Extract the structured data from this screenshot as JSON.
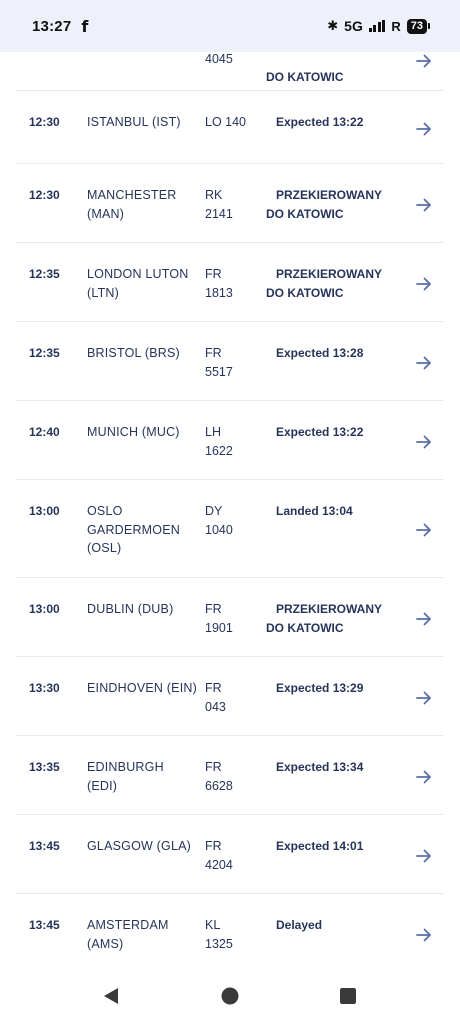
{
  "status_bar": {
    "time": "13:27",
    "network": "5G",
    "battery": "73"
  },
  "flights": [
    {
      "time": "",
      "destination": "",
      "flight_line1": "",
      "flight_line2": "4045",
      "status_line1": "",
      "status_line2": "DO KATOWIC",
      "status_type": "diverted"
    },
    {
      "time": "12:30",
      "destination": "ISTANBUL (IST)",
      "flight_line1": "LO 140",
      "flight_line2": "",
      "status_line1": "Expected 13:22",
      "status_line2": "",
      "status_type": "normal"
    },
    {
      "time": "12:30",
      "destination": "MANCHESTER (MAN)",
      "flight_line1": "RK",
      "flight_line2": "2141",
      "status_line1": "PRZEKIEROWANY",
      "status_line2": "DO KATOWIC",
      "status_type": "diverted"
    },
    {
      "time": "12:35",
      "destination": "LONDON LUTON (LTN)",
      "flight_line1": "FR",
      "flight_line2": "1813",
      "status_line1": "PRZEKIEROWANY",
      "status_line2": "DO KATOWIC",
      "status_type": "diverted"
    },
    {
      "time": "12:35",
      "destination": "BRISTOL (BRS)",
      "flight_line1": "FR",
      "flight_line2": "5517",
      "status_line1": "Expected 13:28",
      "status_line2": "",
      "status_type": "normal"
    },
    {
      "time": "12:40",
      "destination": "MUNICH (MUC)",
      "flight_line1": "LH",
      "flight_line2": "1622",
      "status_line1": "Expected 13:22",
      "status_line2": "",
      "status_type": "normal"
    },
    {
      "time": "13:00",
      "destination": "OSLO GARDERMOEN (OSL)",
      "flight_line1": "DY",
      "flight_line2": "1040",
      "status_line1": "Landed 13:04",
      "status_line2": "",
      "status_type": "normal"
    },
    {
      "time": "13:00",
      "destination": "DUBLIN (DUB)",
      "flight_line1": "FR",
      "flight_line2": "1901",
      "status_line1": "PRZEKIEROWANY",
      "status_line2": "DO KATOWIC",
      "status_type": "diverted"
    },
    {
      "time": "13:30",
      "destination": "EINDHOVEN (EIN)",
      "flight_line1": "FR",
      "flight_line2": "043",
      "status_line1": "Expected 13:29",
      "status_line2": "",
      "status_type": "normal"
    },
    {
      "time": "13:35",
      "destination": "EDINBURGH (EDI)",
      "flight_line1": "FR",
      "flight_line2": "6628",
      "status_line1": "Expected 13:34",
      "status_line2": "",
      "status_type": "normal"
    },
    {
      "time": "13:45",
      "destination": "GLASGOW (GLA)",
      "flight_line1": "FR",
      "flight_line2": "4204",
      "status_line1": "Expected 14:01",
      "status_line2": "",
      "status_type": "normal"
    },
    {
      "time": "13:45",
      "destination": "AMSTERDAM (AMS)",
      "flight_line1": "KL",
      "flight_line2": "1325",
      "status_line1": "Delayed",
      "status_line2": "",
      "status_type": "normal"
    }
  ],
  "colors": {
    "text": "#27345a",
    "arrow": "#5a6fa8",
    "divider": "#e7e9ef",
    "status_bar_bg": "#eef0fa"
  },
  "icons": {
    "row_action": "arrow-right-icon",
    "nav": [
      "back-triangle-icon",
      "home-circle-icon",
      "recents-square-icon"
    ]
  }
}
